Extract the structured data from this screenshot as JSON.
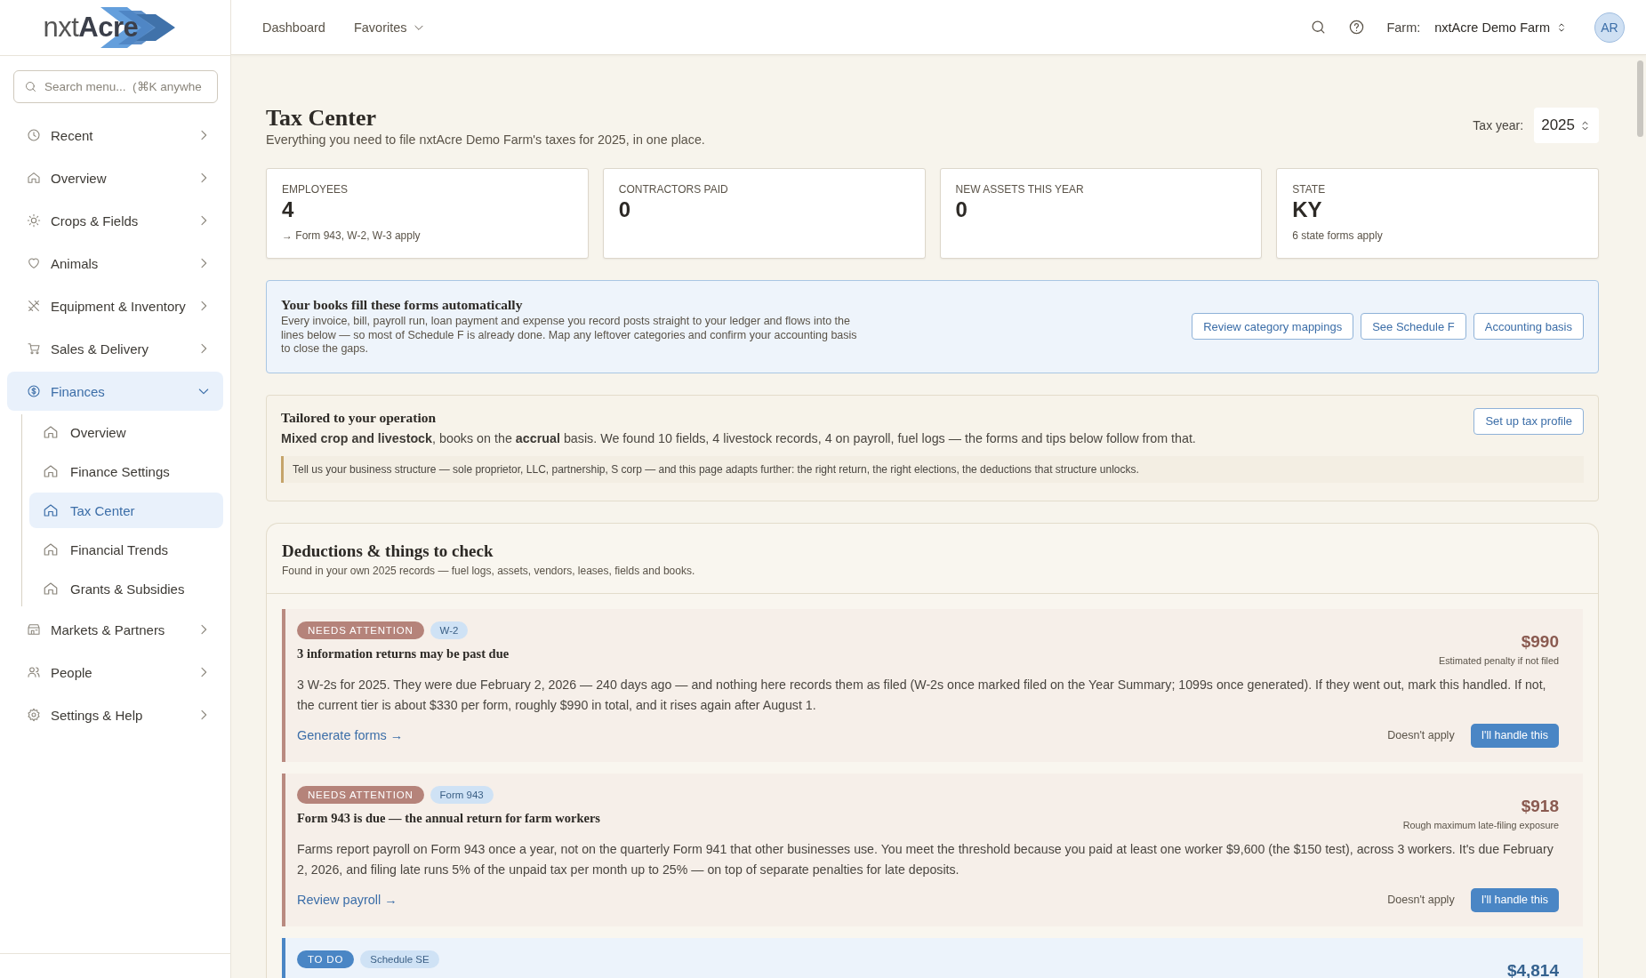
{
  "logo": {
    "text": "nxt**Acre**"
  },
  "sidebar": {
    "search": {
      "placeholder": "Search menu...  (⌘K anywhe"
    },
    "items": [
      {
        "label": "Recent",
        "expanded": false,
        "selected": false
      },
      {
        "label": "Overview",
        "expanded": false,
        "selected": false
      },
      {
        "label": "Crops & Fields",
        "expanded": false,
        "selected": false
      },
      {
        "label": "Animals",
        "expanded": false,
        "selected": false
      },
      {
        "label": "Equipment & Inventory",
        "expanded": false,
        "selected": false
      },
      {
        "label": "Sales & Delivery",
        "expanded": false,
        "selected": false
      },
      {
        "label": "Finances",
        "expanded": true,
        "selected": true,
        "children": [
          {
            "label": "Overview",
            "selected": false
          },
          {
            "label": "Finance Settings",
            "selected": false
          },
          {
            "label": "Tax Center",
            "selected": true
          },
          {
            "label": "Financial Trends",
            "selected": false
          },
          {
            "label": "Grants & Subsidies",
            "selected": false
          }
        ]
      },
      {
        "label": "Markets & Partners",
        "expanded": false,
        "selected": false
      },
      {
        "label": "People",
        "expanded": false,
        "selected": false
      },
      {
        "label": "Settings & Help",
        "expanded": false,
        "selected": false
      }
    ]
  },
  "topbar": {
    "nav": [
      {
        "label": "Dashboard",
        "kind": "link"
      },
      {
        "label": "Favorites",
        "kind": "menu"
      }
    ],
    "farm": {
      "label": "Farm:",
      "value": "nxtAcre Demo Farm"
    },
    "avatar": "AR"
  },
  "page": {
    "title": "Tax Center",
    "subtitle": "Everything you need to file nxtAcre Demo Farm's taxes for 2025, in one place.",
    "tax_year": {
      "label": "Tax year:",
      "value": "2025"
    }
  },
  "stats": [
    {
      "label": "EMPLOYEES",
      "value": "4",
      "note": "→ Form 943, W-2, W-3 apply"
    },
    {
      "label": "CONTRACTORS PAID",
      "value": "0"
    },
    {
      "label": "NEW ASSETS THIS YEAR",
      "value": "0"
    },
    {
      "label": "STATE",
      "value": "KY",
      "note": "6 state forms apply"
    }
  ],
  "banner": {
    "title": "Your books fill these forms automatically",
    "text": "Every invoice, bill, payroll run, loan payment and expense you record posts straight to your ledger and flows into the lines below — so most of Schedule F is already done. Map any leftover categories and confirm your accounting basis to close the gaps.",
    "buttons": [
      "Review category mappings",
      "See Schedule F",
      "Accounting basis"
    ]
  },
  "tailored": {
    "title": "Tailored to your operation",
    "text": "**Mixed crop and livestock**, books on the **accrual** basis. We found 10 fields, 4 livestock records, 4 on payroll, fuel logs — the forms and tips below follow from that.",
    "note": "Tell us your business structure — sole proprietor, LLC, partnership, S corp — and this page adapts further: the right return, the right elections, the deductions that structure unlocks.",
    "button": "Set up tax profile"
  },
  "deductions": {
    "title": "Deductions & things to check",
    "subtitle": "Found in your own 2025 records — fuel logs, assets, vendors, leases, fields and books.",
    "items": [
      {
        "kind": "attention",
        "status": "NEEDS ATTENTION",
        "tag": "W-2",
        "title": "3 information returns may be past due",
        "amount": "$990",
        "amount_note": "Estimated penalty if not filed",
        "text": "3 W-2s for 2025. They were due February 2, 2026 — 240 days ago — and nothing here records them as filed (W-2s once marked filed on the Year Summary; 1099s once generated). If they went out, mark this handled. If not, the current tier is about $330 per form, roughly $990 in total, and it rises again after August 1.",
        "link": "Generate forms →",
        "secondary": "Doesn't apply",
        "primary": "I'll handle this"
      },
      {
        "kind": "attention",
        "status": "NEEDS ATTENTION",
        "tag": "Form 943",
        "title": "Form 943 is due — the annual return for farm workers",
        "amount": "$918",
        "amount_note": "Rough maximum late-filing exposure",
        "text": "Farms report payroll on Form 943 once a year, not on the quarterly Form 941 that other businesses use. You meet the threshold because you paid at least one worker $9,600 (the $150 test), across 3 workers. It's due February 2, 2026, and filing late runs 5% of the unpaid tax per month up to 25% — on top of separate penalties for late deposits.",
        "link": "Review payroll →",
        "secondary": "Doesn't apply",
        "primary": "I'll handle this"
      },
      {
        "kind": "todo",
        "status": "TO DO",
        "tag": "Schedule SE",
        "amount": "$4,814"
      }
    ]
  }
}
